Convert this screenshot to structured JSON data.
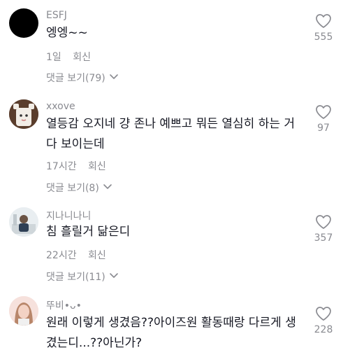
{
  "comments": [
    {
      "username": "ESFJ",
      "text": "엥엥~~",
      "time": "1일",
      "reply_label": "회신",
      "view_replies": "댓글 보기(79)",
      "likes": "555",
      "avatar_color": "#000000"
    },
    {
      "username": "xxove",
      "text": "열등감 오지네 걍 존나 예쁘고 뭐든 열심히 하는 거 다 보이는데",
      "time": "17시간",
      "reply_label": "회신",
      "view_replies": "댓글 보기(8)",
      "likes": "97",
      "avatar_color": "#8c5a3c"
    },
    {
      "username": "지나니나니",
      "text": "침 흘릴거 닮은디",
      "time": "22시간",
      "reply_label": "회신",
      "view_replies": "댓글 보기(11)",
      "likes": "357",
      "avatar_color": "#e6ecef"
    },
    {
      "username": "뚜비•ᴗ•",
      "text": "원래 이렇게 생겼음??아이즈원 활동때랑 다르게 생겼는디...??아닌가?",
      "likes": "228",
      "avatar_color": "#f4d9d4"
    }
  ],
  "colors": {
    "secondary_text": "#8a8b91",
    "primary_text": "#161823"
  },
  "icons": {
    "like": "heart-outline-icon",
    "expand": "chevron-down-icon"
  }
}
